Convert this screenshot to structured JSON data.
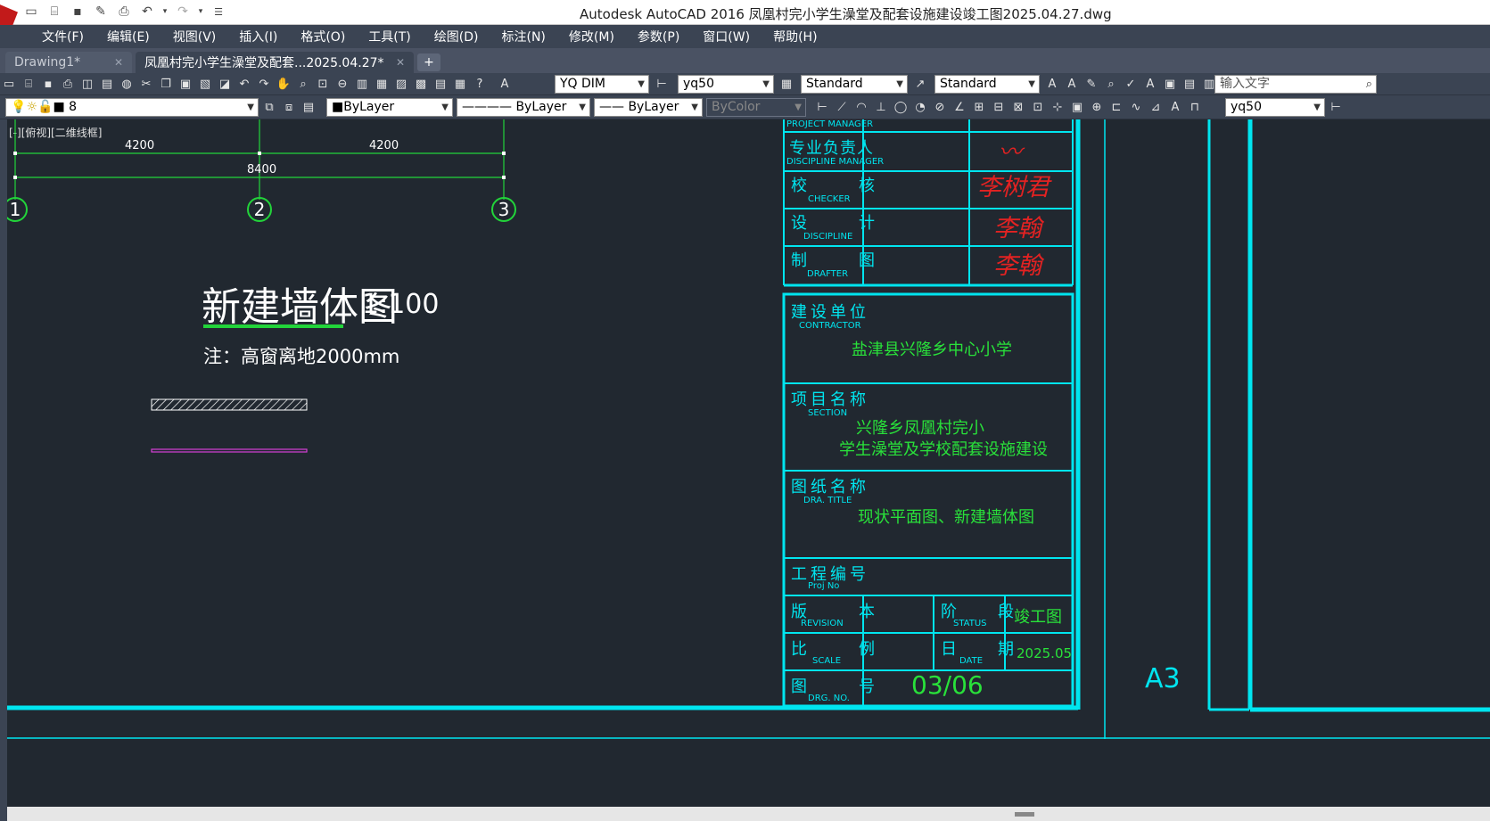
{
  "window": {
    "title": "Autodesk AutoCAD 2016    凤凰村完小学生澡堂及配套设施建设竣工图2025.04.27.dwg"
  },
  "menu": [
    {
      "key": "file",
      "label": "文件(F)"
    },
    {
      "key": "edit",
      "label": "编辑(E)"
    },
    {
      "key": "view",
      "label": "视图(V)"
    },
    {
      "key": "insert",
      "label": "插入(I)"
    },
    {
      "key": "format",
      "label": "格式(O)"
    },
    {
      "key": "tools",
      "label": "工具(T)"
    },
    {
      "key": "draw",
      "label": "绘图(D)"
    },
    {
      "key": "dimension",
      "label": "标注(N)"
    },
    {
      "key": "modify",
      "label": "修改(M)"
    },
    {
      "key": "params",
      "label": "参数(P)"
    },
    {
      "key": "window",
      "label": "窗口(W)"
    },
    {
      "key": "help",
      "label": "帮助(H)"
    }
  ],
  "tabs": {
    "drawing1": "Drawing1*",
    "main": "凤凰村完小学生澡堂及配套...2025.04.27*",
    "close": "✕",
    "new": "+"
  },
  "toolbar1": {
    "text_style": "YQ DIM",
    "dim_style": "yq50",
    "table_style": "Standard",
    "multileader_style": "Standard",
    "search_placeholder": "输入文字"
  },
  "toolbar2": {
    "layer": "8",
    "color": "ByLayer",
    "linetype": "ByLayer",
    "lineweight": "ByLayer",
    "plotstyle": "ByColor",
    "dim_scale": "yq50"
  },
  "canvas": {
    "viewport_label": "[-][俯视][二维线框]",
    "dims": {
      "span1": "4200",
      "span2": "4200",
      "total": "8400"
    },
    "axes": [
      "1",
      "2",
      "3"
    ],
    "drawing_title": "新建墙体图",
    "drawing_scale": "1:100",
    "note": "注：高窗离地2000mm",
    "sheet_size": "A3"
  },
  "title_block": {
    "project_manager_en": "PROJECT MANAGER",
    "discipline_manager_cn": "专业负责人",
    "discipline_manager_en": "DISCIPLINE MANAGER",
    "checker_cn": "校　核",
    "checker_en": "CHECKER",
    "checker_sig": "李树君",
    "discipline_cn": "设　计",
    "discipline_en": "DISCIPLINE",
    "discipline_sig": "李翰",
    "drafter_cn": "制　图",
    "drafter_en": "DRAFTER",
    "drafter_sig": "李翰",
    "contractor_cn": "建设单位",
    "contractor_en": "CONTRACTOR",
    "contractor_val": "盐津县兴隆乡中心小学",
    "section_cn": "项目名称",
    "section_en": "SECTION",
    "section_val1": "兴隆乡凤凰村完小",
    "section_val2": "学生澡堂及学校配套设施建设",
    "dra_title_cn": "图纸名称",
    "dra_title_en": "DRA. TITLE",
    "dra_title_val": "现状平面图、新建墙体图",
    "proj_no_cn": "工程编号",
    "proj_no_en": "Proj No",
    "revision_cn": "版　本",
    "revision_en": "REVISION",
    "status_cn": "阶　段",
    "status_en": "STATUS",
    "status_val": "竣工图",
    "scale_cn": "比　例",
    "scale_en": "SCALE",
    "date_cn": "日　期",
    "date_en": "DATE",
    "date_val": "2025.05",
    "drg_no_cn": "图　号",
    "drg_no_en": "DRG. NO.",
    "drg_no_val": "03/06"
  }
}
